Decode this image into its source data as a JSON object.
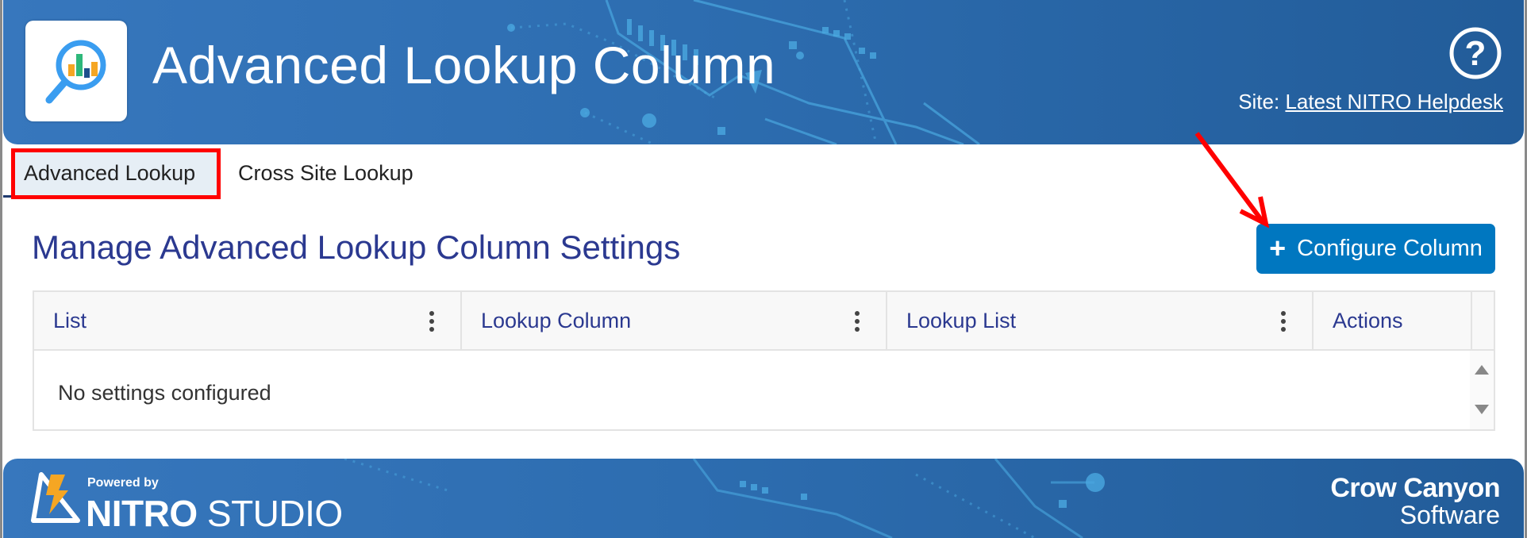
{
  "header": {
    "app_title": "Advanced Lookup Column",
    "logo_icon": "magnifier-chart-icon",
    "help_icon": "help-circle-icon",
    "site_prefix": "Site: ",
    "site_link": "Latest NITRO Helpdesk"
  },
  "tabs": [
    {
      "label": "Advanced Lookup",
      "active": true
    },
    {
      "label": "Cross Site Lookup",
      "active": false
    }
  ],
  "main": {
    "section_title": "Manage Advanced Lookup Column Settings",
    "configure_button": {
      "icon": "plus-icon",
      "label": "Configure Column"
    },
    "grid": {
      "columns": [
        {
          "label": "List",
          "has_menu": true
        },
        {
          "label": "Lookup Column",
          "has_menu": true
        },
        {
          "label": "Lookup List",
          "has_menu": true
        },
        {
          "label": "Actions",
          "has_menu": false
        }
      ],
      "rows": [],
      "empty_message": "No settings configured"
    }
  },
  "annotations": {
    "highlight_color": "#ff0000",
    "arrow_color": "#ff0000"
  },
  "footer": {
    "powered_by": "Powered by",
    "brand_bold": "NITRO",
    "brand_light": " STUDIO",
    "company_line1": "Crow Canyon",
    "company_line2": "Software"
  },
  "colors": {
    "header_blue": "#2d6db0",
    "accent_button": "#0077c0",
    "heading_text": "#2b3990",
    "active_tab_bg": "#e6eef5"
  }
}
